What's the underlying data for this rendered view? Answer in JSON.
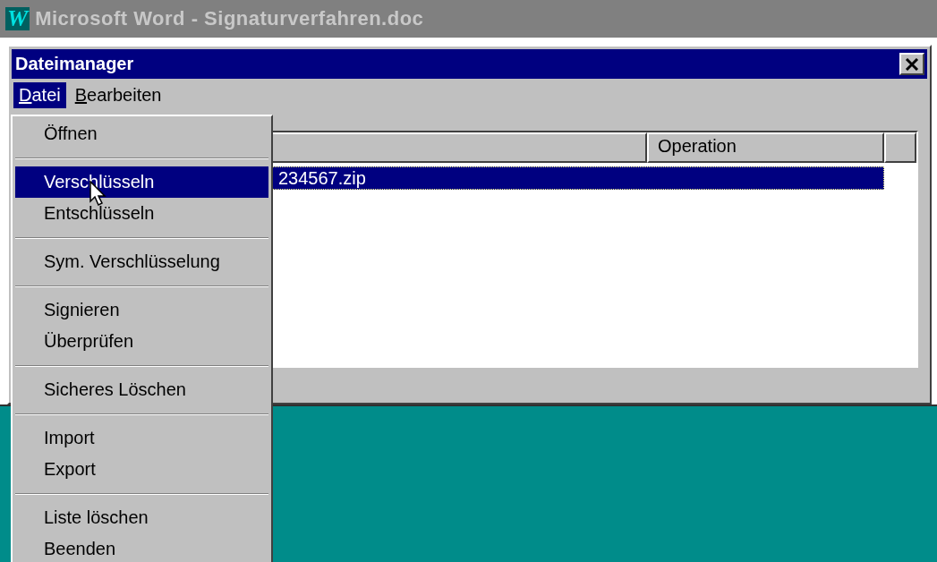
{
  "app_window": {
    "icon_letter": "W",
    "title": "Microsoft Word - Signaturverfahren.doc"
  },
  "dialog": {
    "title": "Dateimanager",
    "menu_bar": [
      {
        "mnemonic": "D",
        "rest": "atei",
        "selected": true
      },
      {
        "mnemonic": "B",
        "rest": "earbeiten",
        "selected": false
      }
    ],
    "list": {
      "columns": [
        "",
        "Operation",
        ""
      ],
      "rows": [
        {
          "cells": [
            "234567.zip"
          ],
          "selected": true
        }
      ]
    }
  },
  "open_menu": {
    "groups": [
      [
        {
          "label": "Öffnen",
          "selected": false
        }
      ],
      [
        {
          "label": "Verschlüsseln",
          "selected": true
        },
        {
          "label": "Entschlüsseln",
          "selected": false
        }
      ],
      [
        {
          "label": "Sym. Verschlüsselung",
          "selected": false
        }
      ],
      [
        {
          "label": "Signieren",
          "selected": false
        },
        {
          "label": "Überprüfen",
          "selected": false
        }
      ],
      [
        {
          "label": "Sicheres Löschen",
          "selected": false
        }
      ],
      [
        {
          "label": "Import",
          "selected": false
        },
        {
          "label": "Export",
          "selected": false
        }
      ],
      [
        {
          "label": "Liste löschen",
          "selected": false
        },
        {
          "label": "Beenden",
          "selected": false
        }
      ]
    ]
  }
}
